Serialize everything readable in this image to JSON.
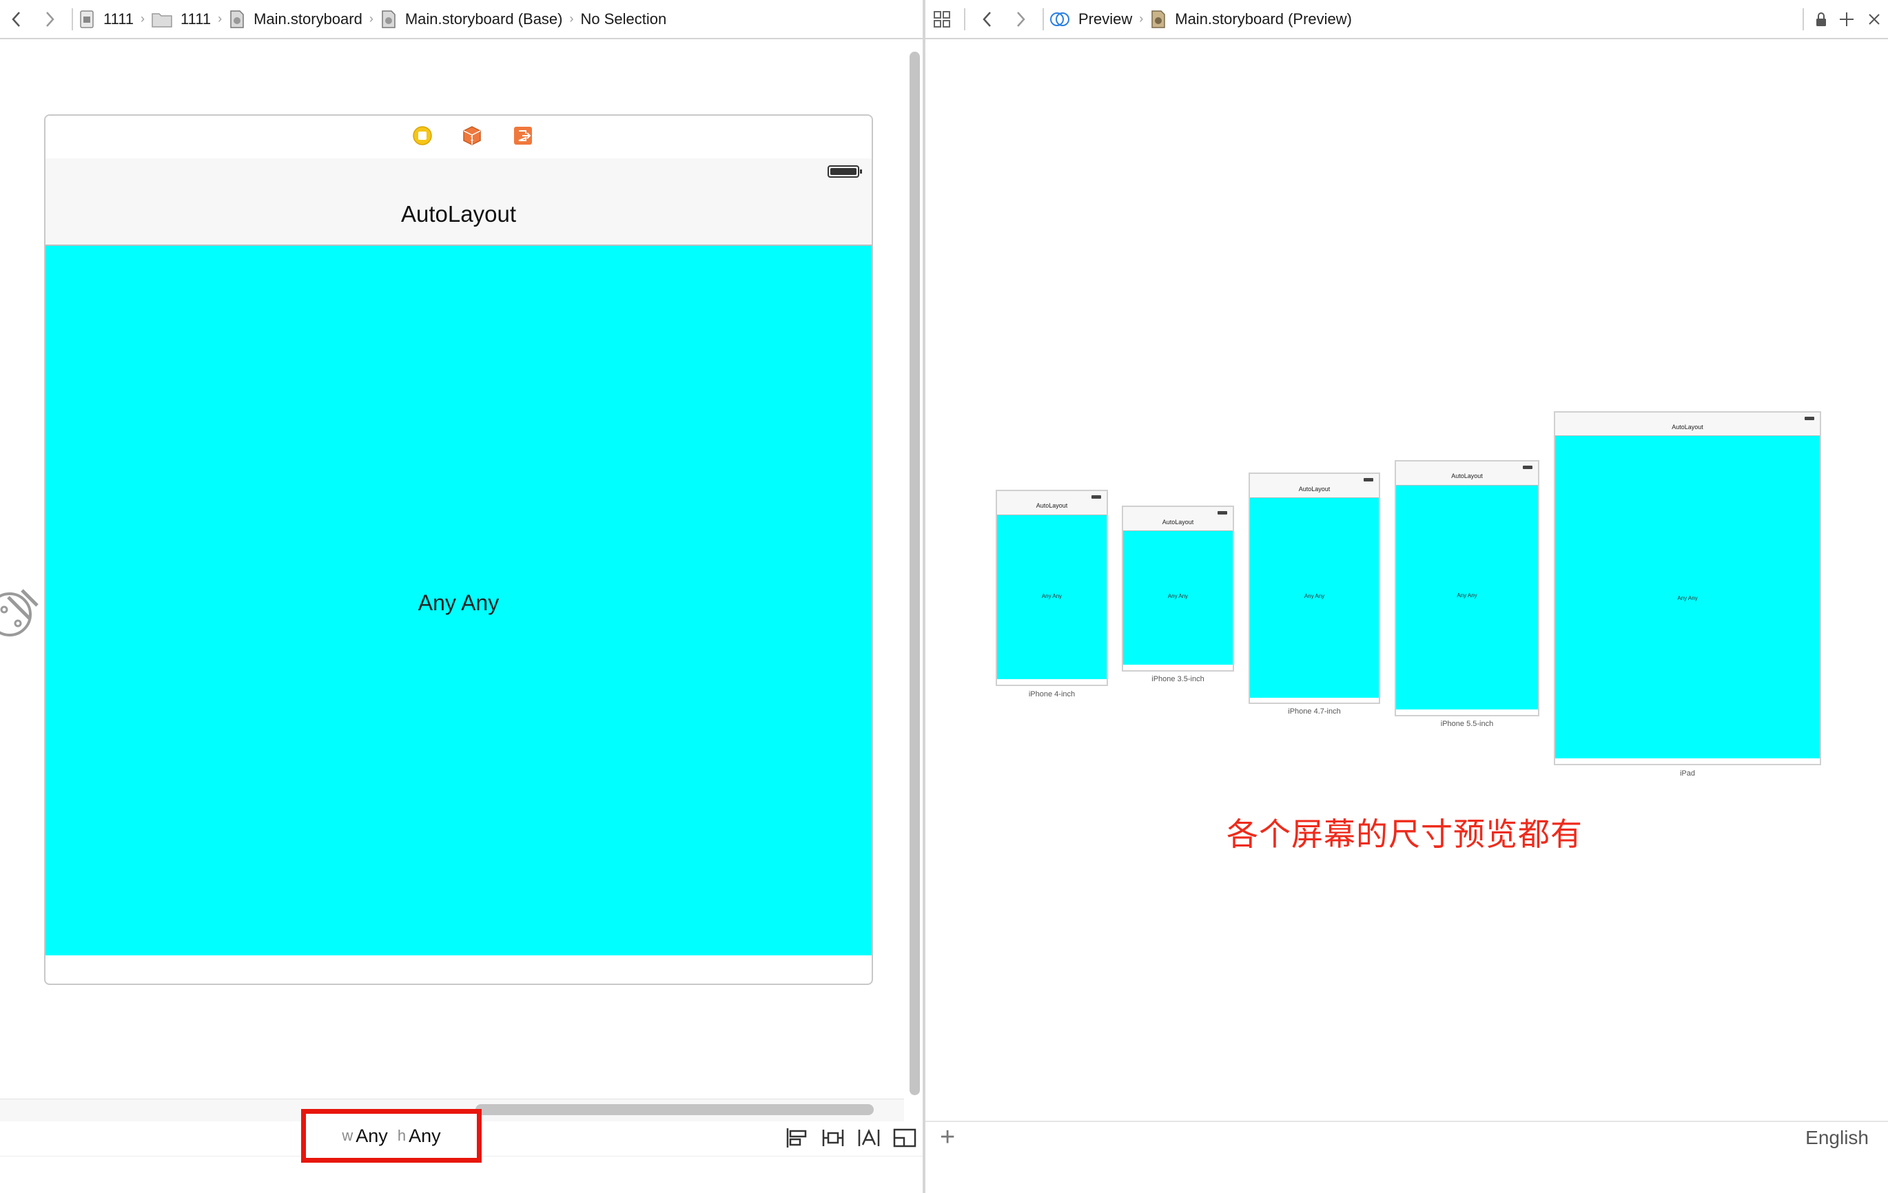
{
  "left_jumpbar": {
    "crumbs": [
      "1111",
      "1111",
      "Main.storyboard",
      "Main.storyboard (Base)",
      "No Selection"
    ]
  },
  "right_jumpbar": {
    "crumbs": [
      "Preview",
      "Main.storyboard (Preview)"
    ]
  },
  "scene": {
    "nav_title": "AutoLayout",
    "content_label": "Any Any"
  },
  "size_class": {
    "w_prefix": "w",
    "w_value": "Any",
    "h_prefix": "h",
    "h_value": "Any"
  },
  "colors": {
    "content_background": "#00ffff",
    "highlight_box": "#e8160c",
    "annotation_text": "#ee2b1c"
  },
  "preview": {
    "devices": [
      {
        "name": "iPhone 4-inch",
        "title": "AutoLayout",
        "label": "Any Any"
      },
      {
        "name": "iPhone 3.5-inch",
        "title": "AutoLayout",
        "label": "Any Any"
      },
      {
        "name": "iPhone 4.7-inch",
        "title": "AutoLayout",
        "label": "Any Any"
      },
      {
        "name": "iPhone 5.5-inch",
        "title": "AutoLayout",
        "label": "Any Any"
      },
      {
        "name": "iPad",
        "title": "AutoLayout",
        "label": "Any Any"
      }
    ],
    "annotation": "各个屏幕的尺寸预览都有",
    "language": "English"
  },
  "icons": [
    "back-icon",
    "forward-icon",
    "project-icon",
    "folder-icon",
    "storyboard-icon",
    "related-items-icon",
    "preview-icon",
    "lock-icon",
    "add-editor-icon",
    "close-editor-icon",
    "view-controller-icon",
    "first-responder-icon",
    "exit-icon",
    "entry-arrow-icon",
    "align-icon",
    "pin-icon",
    "resolve-icon",
    "resizing-icon",
    "add-icon"
  ]
}
